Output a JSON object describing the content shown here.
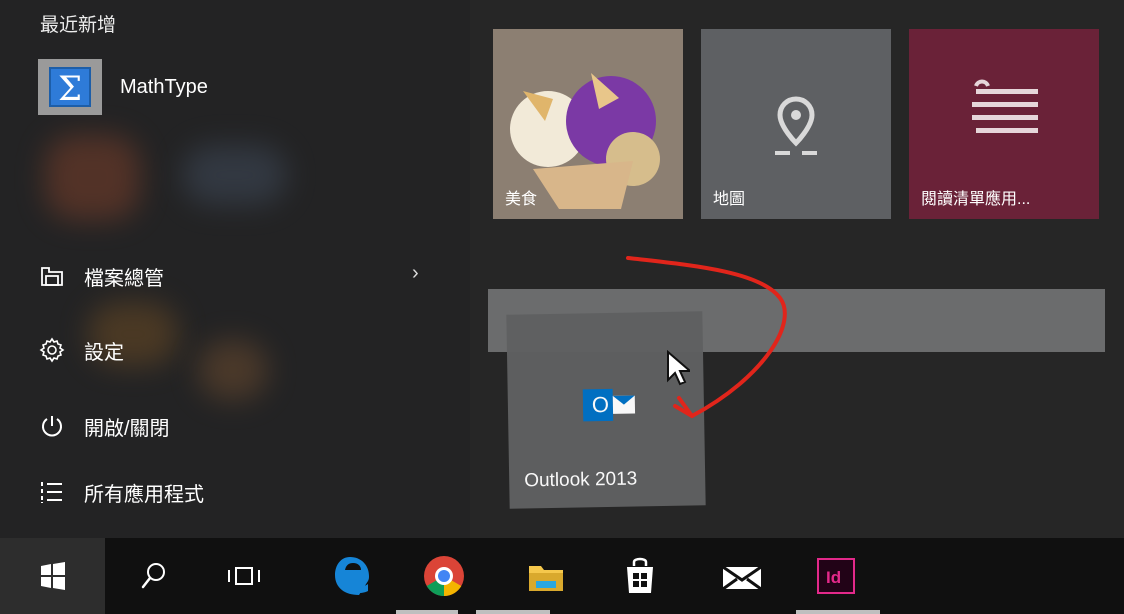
{
  "start_menu": {
    "recent_header": "最近新增",
    "recent_apps": [
      {
        "name": "MathType",
        "icon": "mathtype-sigma-icon"
      }
    ],
    "nav": [
      {
        "label": "檔案總管",
        "icon": "file-explorer-icon",
        "has_submenu": true
      },
      {
        "label": "設定",
        "icon": "settings-gear-icon"
      },
      {
        "label": "開啟/關閉",
        "icon": "power-icon"
      },
      {
        "label": "所有應用程式",
        "icon": "all-apps-list-icon"
      }
    ]
  },
  "tiles": [
    {
      "label": "美食",
      "icon": "food-photo",
      "color": "#8c7f72"
    },
    {
      "label": "地圖",
      "icon": "map-pin-icon",
      "color": "#5e6063"
    },
    {
      "label": "閱讀清單應用...",
      "icon": "reading-list-icon",
      "color": "#6a2238"
    }
  ],
  "dragging_tile": {
    "label": "Outlook 2013",
    "icon": "outlook-icon",
    "color": "#5f6061"
  },
  "taskbar": {
    "items": [
      {
        "name": "start",
        "icon": "windows-logo-icon"
      },
      {
        "name": "search",
        "icon": "search-icon"
      },
      {
        "name": "task-view",
        "icon": "task-view-icon"
      },
      {
        "name": "edge",
        "icon": "edge-icon"
      },
      {
        "name": "chrome",
        "icon": "chrome-icon"
      },
      {
        "name": "file-explorer",
        "icon": "folder-icon"
      },
      {
        "name": "store",
        "icon": "store-bag-icon"
      },
      {
        "name": "mail",
        "icon": "mail-icon"
      },
      {
        "name": "indesign",
        "icon": "indesign-icon",
        "text": "Id"
      }
    ]
  },
  "colors": {
    "start_bg": "#262626",
    "taskbar_bg": "#101010",
    "accent_red": "#e1251b",
    "outlook_blue": "#0072c6"
  }
}
